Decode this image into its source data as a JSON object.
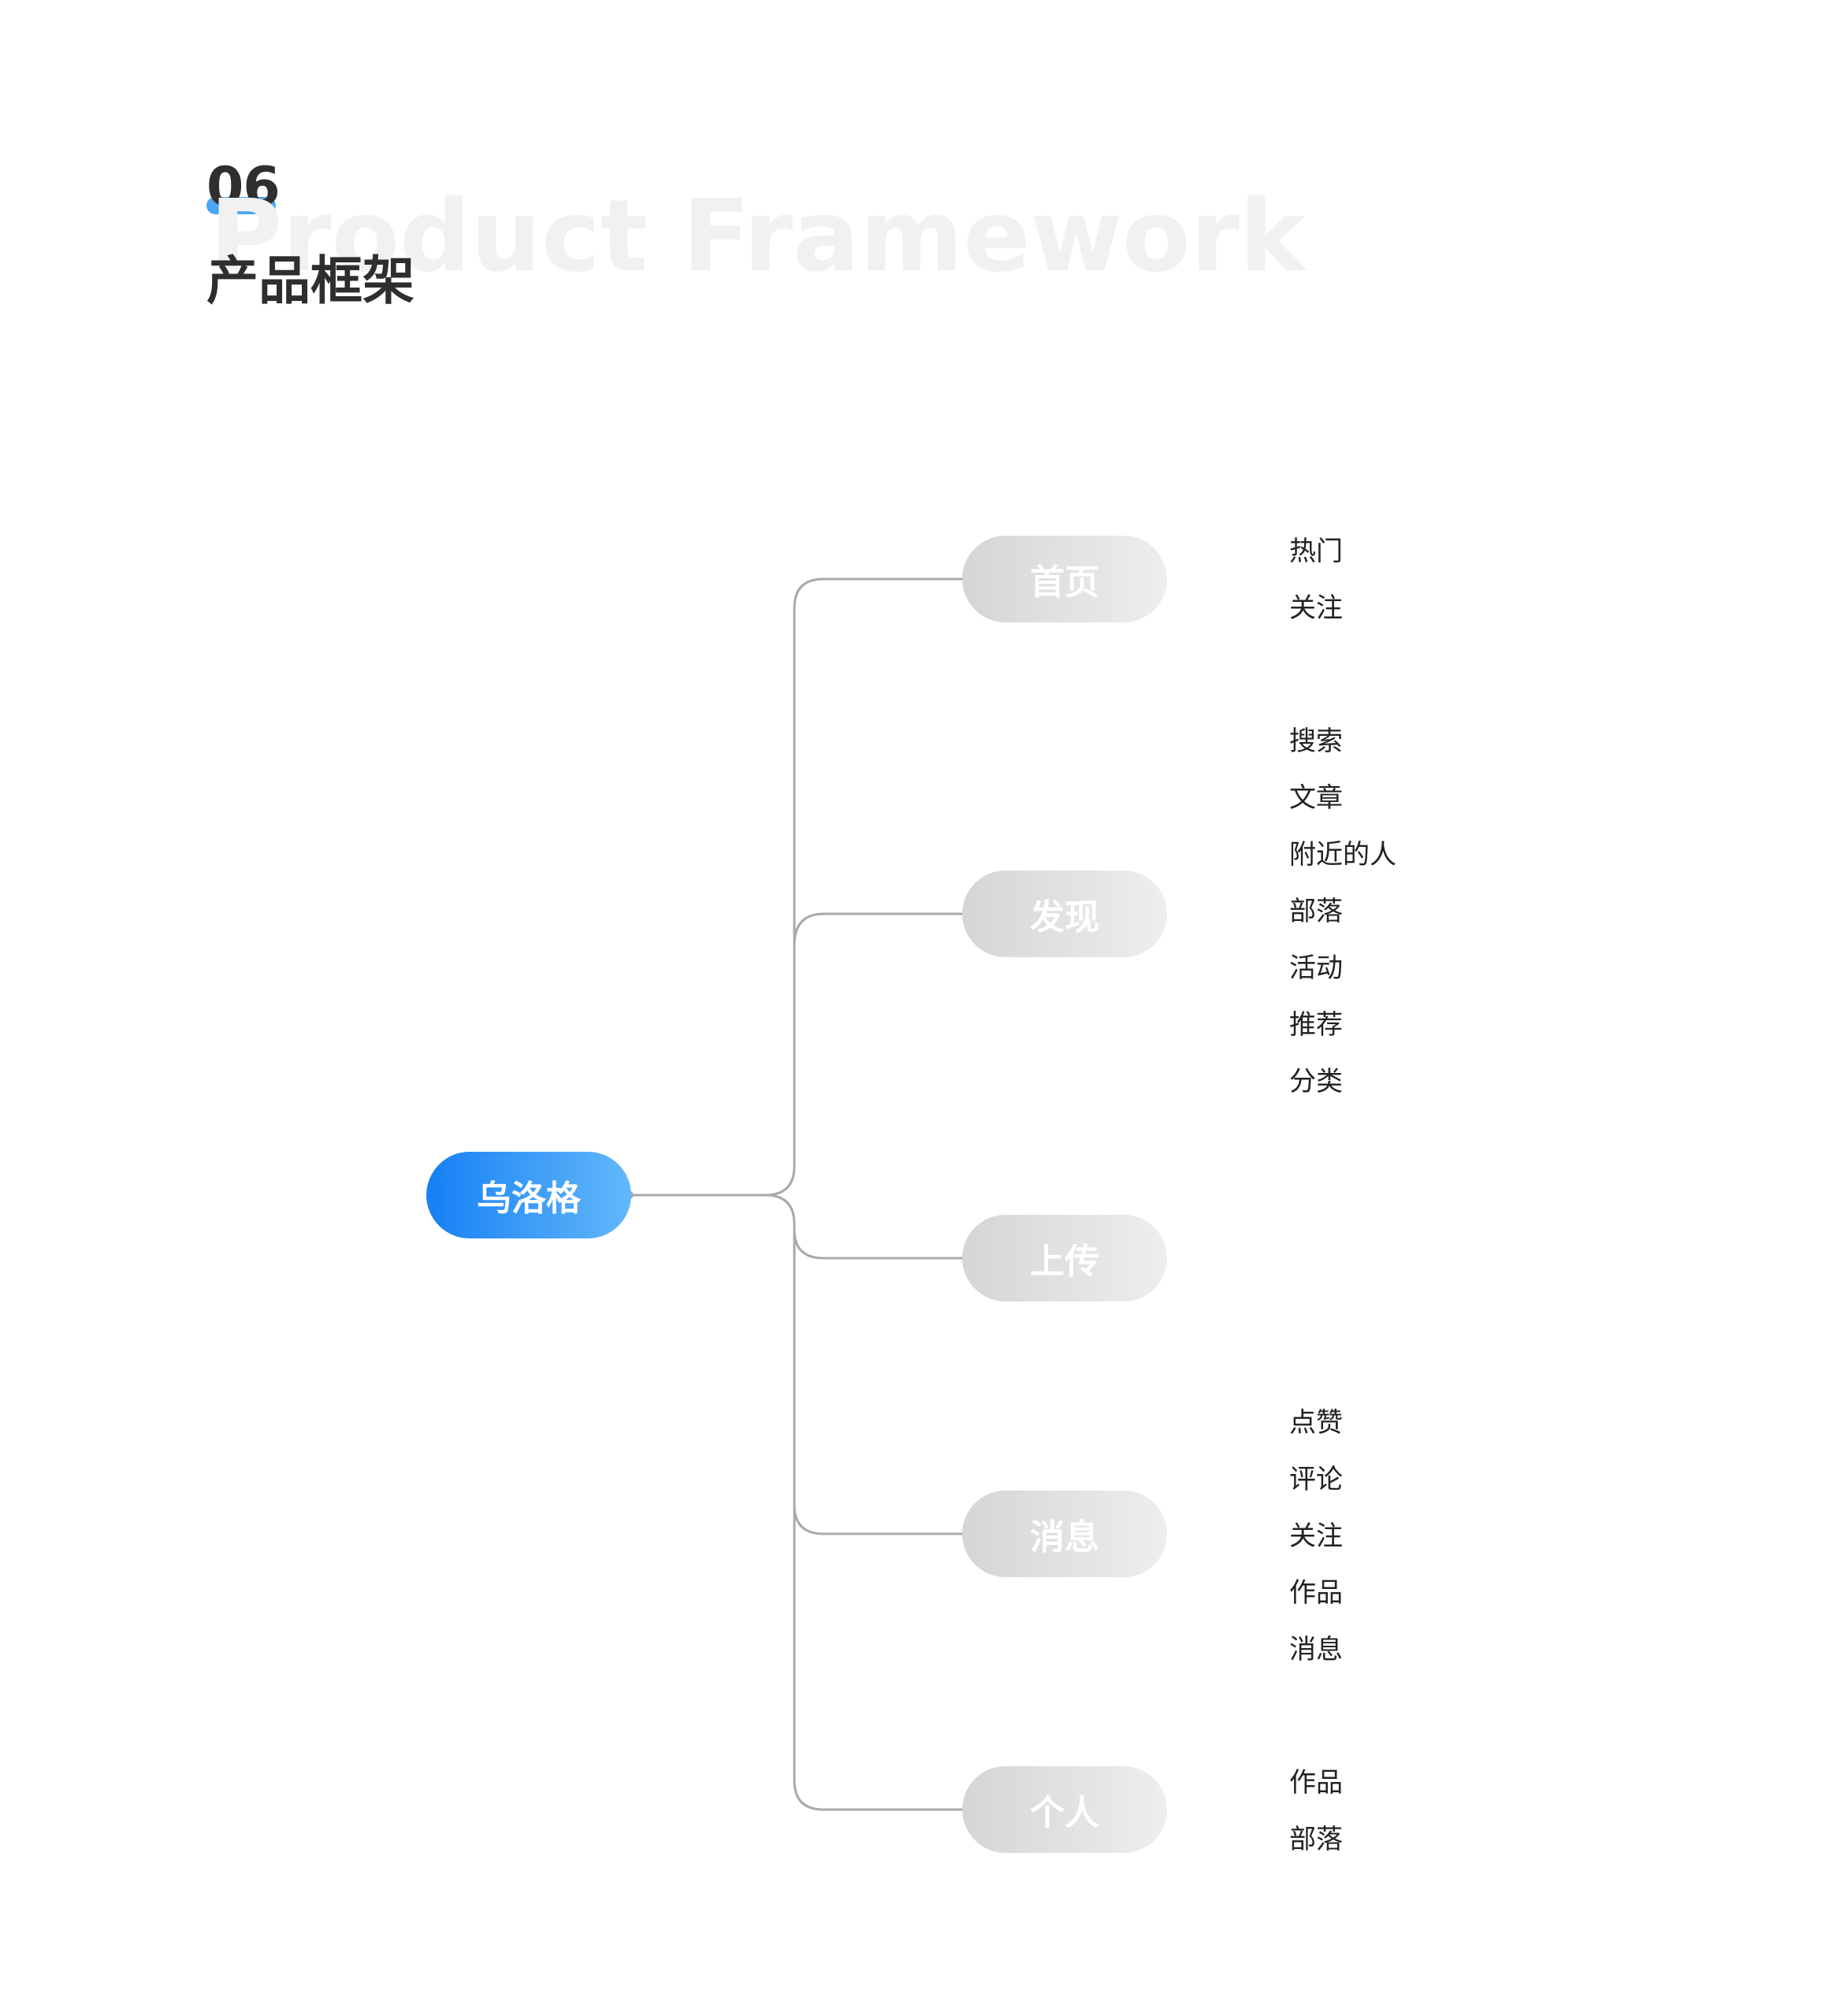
{
  "header": {
    "section_number": "06",
    "watermark": "Product Framework",
    "title": "产品框架"
  },
  "diagram": {
    "root": {
      "label": "乌洛格",
      "color": "#1680f5"
    },
    "branches": [
      {
        "label": "首页",
        "children": [
          "热门",
          "关注"
        ]
      },
      {
        "label": "发现",
        "children": [
          "搜索",
          "文章",
          "附近的人",
          "部落",
          "活动",
          "推荐",
          "分类"
        ]
      },
      {
        "label": "上传",
        "children": []
      },
      {
        "label": "消息",
        "children": [
          "点赞",
          "评论",
          "关注",
          "作品",
          "消息"
        ]
      },
      {
        "label": "个人",
        "children": [
          "作品",
          "部落"
        ]
      }
    ]
  }
}
